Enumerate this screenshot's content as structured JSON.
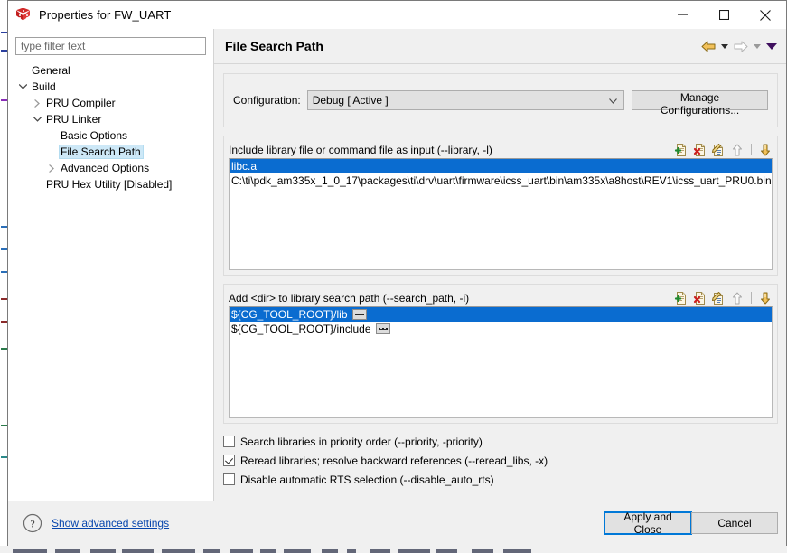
{
  "window": {
    "title": "Properties for FW_UART",
    "icon": "cube-icon",
    "controls": {
      "minimize": "minimize-icon",
      "maximize": "maximize-icon",
      "close": "close-icon"
    }
  },
  "sidebar": {
    "filter": {
      "placeholder": "type filter text",
      "value": ""
    },
    "items": [
      {
        "label": "General",
        "indent": 1,
        "twisty": "none",
        "selected": false
      },
      {
        "label": "Build",
        "indent": 1,
        "twisty": "expanded",
        "selected": false
      },
      {
        "label": "PRU Compiler",
        "indent": 2,
        "twisty": "collapsed",
        "selected": false
      },
      {
        "label": "PRU Linker",
        "indent": 2,
        "twisty": "expanded",
        "selected": false
      },
      {
        "label": "Basic Options",
        "indent": 3,
        "twisty": "none",
        "selected": false
      },
      {
        "label": "File Search Path",
        "indent": 3,
        "twisty": "none",
        "selected": true
      },
      {
        "label": "Advanced Options",
        "indent": 3,
        "twisty": "collapsed",
        "selected": false
      },
      {
        "label": "PRU Hex Utility  [Disabled]",
        "indent": 2,
        "twisty": "none",
        "selected": false
      }
    ]
  },
  "page": {
    "title": "File Search Path",
    "nav": {
      "back": "back-arrow-icon",
      "back_menu": "chevron-down-icon",
      "forward": "forward-arrow-icon",
      "forward_menu": "chevron-down-icon",
      "more_menu": "chevron-down-filled-icon"
    },
    "configuration": {
      "label": "Configuration:",
      "value": "Debug  [ Active ]",
      "dropdown_icon": "chevron-down-icon",
      "manage_button": "Manage Configurations..."
    },
    "lists": [
      {
        "header": "Include library file or command file as input (--library, -l)",
        "tools": [
          "add-icon",
          "delete-icon",
          "edit-icon",
          "move-up-icon",
          "move-down-icon"
        ],
        "items": [
          {
            "text": "libc.a",
            "selected": true,
            "browse": false
          },
          {
            "text": "C:\\ti\\pdk_am335x_1_0_17\\packages\\ti\\drv\\uart\\firmware\\icss_uart\\bin\\am335x\\a8host\\REV1\\icss_uart_PRU0.bin",
            "selected": false,
            "browse": false
          }
        ]
      },
      {
        "header": "Add <dir> to library search path (--search_path, -i)",
        "tools": [
          "add-icon",
          "delete-icon",
          "edit-icon",
          "move-up-icon",
          "move-down-icon"
        ],
        "items": [
          {
            "text": "${CG_TOOL_ROOT}/lib",
            "selected": true,
            "browse": true
          },
          {
            "text": "${CG_TOOL_ROOT}/include",
            "selected": false,
            "browse": true
          }
        ]
      }
    ],
    "checkboxes": [
      {
        "label": "Search libraries in priority order (--priority, -priority)",
        "checked": false
      },
      {
        "label": "Reread libraries; resolve backward references (--reread_libs, -x)",
        "checked": true
      },
      {
        "label": "Disable automatic RTS selection (--disable_auto_rts)",
        "checked": false
      }
    ]
  },
  "footer": {
    "help_icon": "help-question-icon",
    "advanced_link": "Show advanced settings",
    "apply_button": "Apply and Close",
    "cancel_button": "Cancel"
  },
  "colors": {
    "selection_blue": "#0a6cd0",
    "tree_selection": "#cde8f7",
    "link": "#0645ad",
    "focus_ring": "#0078d7",
    "dialog_bg": "#f0f0f0"
  }
}
